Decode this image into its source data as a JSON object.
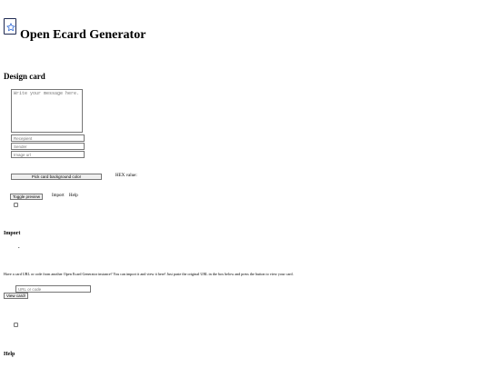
{
  "header": {
    "title": "Open Ecard Generator",
    "logo_icon": "star-card-icon"
  },
  "design": {
    "heading": "Design card",
    "message_placeholder": "Write your message here.",
    "recipient_placeholder": "Recepient",
    "sender_placeholder": "Sender",
    "image_url_placeholder": "Image url",
    "color_button_label": "Pick card background color",
    "hex_label": "HEX value:",
    "toggle_preview_label": "Toggle preview",
    "import_link": "Import",
    "help_link": "Help"
  },
  "import": {
    "heading": "Import",
    "bullet": "•",
    "description": "Have a card URL or code from another Open Ecard Generator instance? You can import it and view it here! Just paste the original URL in the box below and press the button to view your card.",
    "url_placeholder": "URL or code",
    "view_button_label": "View card!"
  },
  "help": {
    "heading": "Help"
  },
  "colors": {
    "logo_stroke": "#1f2a52",
    "star": "#3a6fd8"
  }
}
